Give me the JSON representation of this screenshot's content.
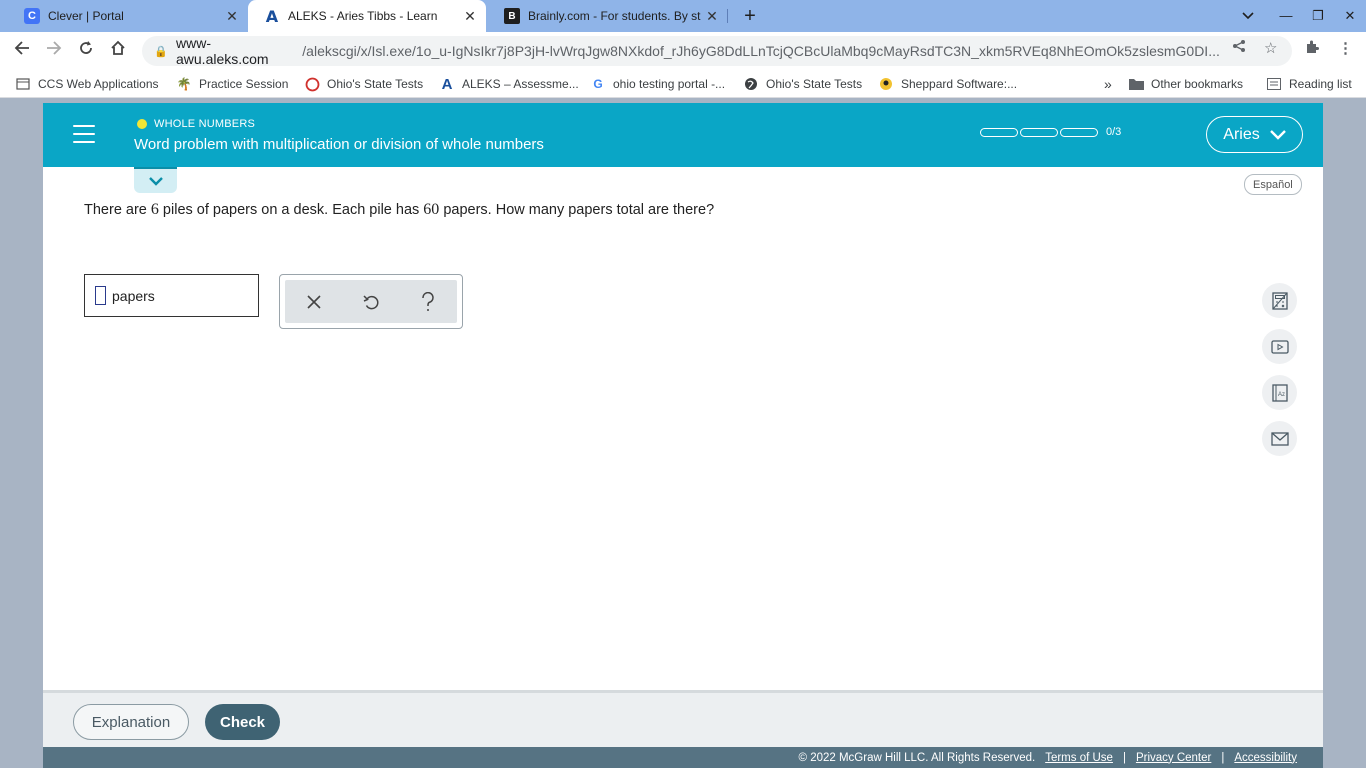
{
  "browser": {
    "tabs": [
      {
        "title": "Clever | Portal",
        "favicon": "clever-icon",
        "active": false
      },
      {
        "title": "ALEKS - Aries Tibbs - Learn",
        "favicon": "aleks-icon",
        "active": true
      },
      {
        "title": "Brainly.com - For students. By st",
        "favicon": "brainly-icon",
        "active": false
      }
    ],
    "url_host": "www-awu.aleks.com",
    "url_path": "/alekscgi/x/Isl.exe/1o_u-IgNsIkr7j8P3jH-lvWrqJgw8NXkdof_rJh6yG8DdLLnTcjQCBcUlaMbq9cMayRsdTC3N_xkm5RVEq8NhEOmOk5zslesmG0DI...",
    "bookmarks": [
      {
        "label": "CCS Web Applications",
        "icon": "page-icon"
      },
      {
        "label": "Practice Session",
        "icon": "palm-icon"
      },
      {
        "label": "Ohio's State Tests",
        "icon": "circle-icon"
      },
      {
        "label": "ALEKS – Assessme...",
        "icon": "aleks-icon"
      },
      {
        "label": "ohio testing portal -...",
        "icon": "google-icon"
      },
      {
        "label": "Ohio's State Tests",
        "icon": "globe-icon"
      },
      {
        "label": "Sheppard Software:...",
        "icon": "sheppard-icon"
      }
    ],
    "other_bookmarks": "Other bookmarks",
    "reading_list": "Reading list"
  },
  "aleks": {
    "topic": "WHOLE NUMBERS",
    "title": "Word problem with multiplication or division of whole numbers",
    "progress_text": "0/3",
    "progress_fraction": 0,
    "user": "Aries",
    "espanol": "Español",
    "question": {
      "part1": "There are ",
      "n1": "6",
      "part2": " piles of papers on a desk. Each pile has ",
      "n2": "60",
      "part3": " papers. How many papers total are there?"
    },
    "answer_value": "",
    "answer_unit": "papers",
    "keypad": [
      "clear-icon",
      "undo-icon",
      "help-icon"
    ],
    "side_tools": [
      "calculator-icon",
      "video-icon",
      "dictionary-icon",
      "mail-icon"
    ],
    "explanation_label": "Explanation",
    "check_label": "Check",
    "footer": {
      "copyright": "© 2022 McGraw Hill LLC. All Rights Reserved.",
      "terms": "Terms of Use",
      "privacy": "Privacy Center",
      "accessibility": "Accessibility",
      "separator": "|"
    }
  },
  "colors": {
    "header": "#0aa6c6",
    "check": "#3f6373",
    "footer": "#567383"
  }
}
